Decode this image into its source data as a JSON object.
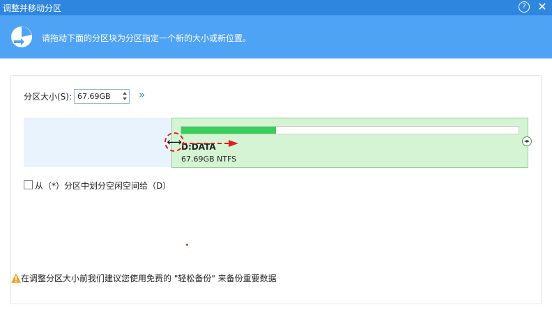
{
  "window": {
    "title": "调整并移动分区",
    "help_label": "?",
    "close_label": "✕"
  },
  "banner": {
    "icon": "partition-resize-icon",
    "text": "请拖动下面的分区块为分区指定一个新的大小或新位置。"
  },
  "size_control": {
    "label": "分区大小(S):",
    "value": "67.69GB",
    "expand_label": "»"
  },
  "partition": {
    "name": "D:DATA",
    "info": "67.69GB NTFS",
    "used_fraction": 0.28,
    "colors": {
      "fill": "#d4f4d4",
      "used_bar": "#39cf5a",
      "unallocated": "#e9f3fd"
    }
  },
  "handles": {
    "left_icon": "resize-left-handle-icon",
    "left_glyph": "⟷",
    "right_icon": "resize-right-handle-icon",
    "right_glyph": "◂▸"
  },
  "checkbox": {
    "label": "从（*）分区中划分空闲空间给（D）",
    "checked": false
  },
  "warning": {
    "icon": "warning-icon",
    "text": "在调整分区大小前我们建议您使用免费的 \"轻松备份\" 来备份重要数据"
  }
}
